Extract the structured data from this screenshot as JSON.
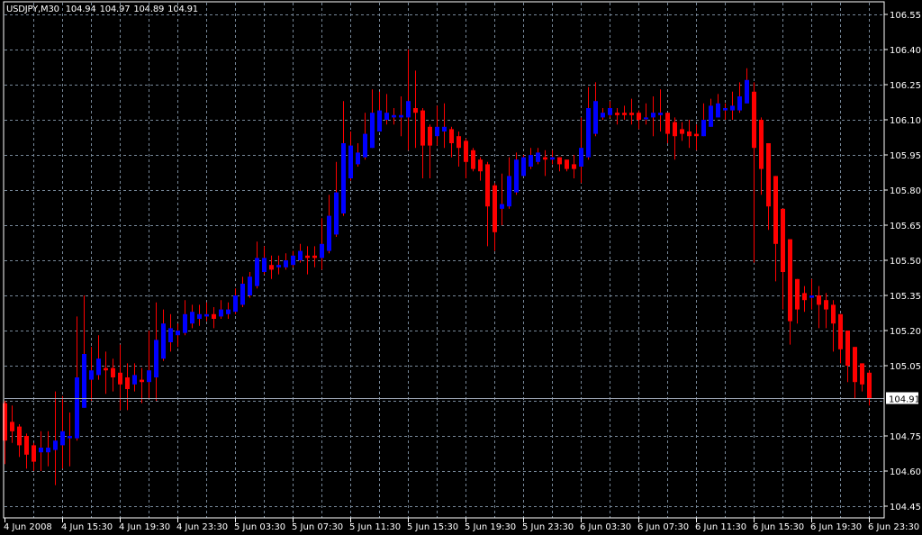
{
  "header": {
    "symbol": "USDJPY,M30",
    "open": "104.94",
    "high": "104.97",
    "low": "104.89",
    "close": "104.91"
  },
  "colors": {
    "background": "#000000",
    "grid": "#778899",
    "bull_body": "#0000ff",
    "bear_body": "#ff0000",
    "wick": "#ff0000",
    "frame": "#ffffff",
    "price_line": "#a0a8b8"
  },
  "chart_data": {
    "type": "candlestick",
    "title": "USDJPY,M30",
    "ylim": [
      104.45,
      106.55
    ],
    "grid": true,
    "y_ticks": [
      "106.55",
      "106.40",
      "106.25",
      "106.10",
      "105.95",
      "105.80",
      "105.65",
      "105.50",
      "105.35",
      "105.20",
      "105.05",
      "104.75",
      "104.60",
      "104.45"
    ],
    "grid_levels": [
      106.55,
      106.4,
      106.25,
      106.1,
      105.95,
      105.8,
      105.65,
      105.5,
      105.35,
      105.2,
      105.05,
      104.9,
      104.75,
      104.6,
      104.45
    ],
    "x_ticks": [
      "4 Jun 2008",
      "4 Jun 15:30",
      "4 Jun 19:30",
      "4 Jun 23:30",
      "5 Jun 03:30",
      "5 Jun 07:30",
      "5 Jun 11:30",
      "5 Jun 15:30",
      "5 Jun 19:30",
      "5 Jun 23:30",
      "6 Jun 03:30",
      "6 Jun 07:30",
      "6 Jun 11:30",
      "6 Jun 15:30",
      "6 Jun 19:30",
      "6 Jun 23:30"
    ],
    "bars_per_x_tick": 8,
    "current_price": "104.91",
    "ohlc": [
      [
        104.89,
        104.9,
        104.63,
        104.73
      ],
      [
        104.81,
        104.88,
        104.72,
        104.77
      ],
      [
        104.79,
        104.8,
        104.66,
        104.71
      ],
      [
        104.75,
        104.76,
        104.61,
        104.67
      ],
      [
        104.71,
        104.72,
        104.6,
        104.64
      ],
      [
        104.68,
        104.77,
        104.6,
        104.7
      ],
      [
        104.68,
        104.77,
        104.62,
        104.7
      ],
      [
        104.69,
        104.94,
        104.54,
        104.73
      ],
      [
        104.71,
        104.92,
        104.61,
        104.77
      ],
      [
        104.74,
        104.85,
        104.62,
        104.75
      ],
      [
        104.74,
        105.26,
        104.73,
        105.0
      ],
      [
        104.87,
        105.35,
        104.87,
        105.1
      ],
      [
        104.99,
        105.13,
        104.9,
        105.03
      ],
      [
        105.01,
        105.18,
        104.99,
        105.08
      ],
      [
        105.04,
        105.11,
        104.93,
        105.03
      ],
      [
        105.04,
        105.08,
        104.94,
        105.0
      ],
      [
        105.02,
        105.14,
        104.86,
        104.97
      ],
      [
        105.0,
        105.06,
        104.86,
        104.95
      ],
      [
        104.97,
        105.06,
        104.94,
        105.01
      ],
      [
        104.99,
        105.04,
        104.89,
        104.98
      ],
      [
        104.98,
        105.2,
        104.91,
        105.03
      ],
      [
        105.0,
        105.32,
        104.9,
        105.16
      ],
      [
        105.08,
        105.29,
        105.07,
        105.23
      ],
      [
        105.15,
        105.27,
        105.11,
        105.21
      ],
      [
        105.18,
        105.23,
        105.13,
        105.2
      ],
      [
        105.19,
        105.33,
        105.18,
        105.27
      ],
      [
        105.23,
        105.31,
        105.21,
        105.28
      ],
      [
        105.25,
        105.31,
        105.22,
        105.27
      ],
      [
        105.26,
        105.32,
        105.24,
        105.27
      ],
      [
        105.27,
        105.3,
        105.21,
        105.25
      ],
      [
        105.26,
        105.33,
        105.25,
        105.29
      ],
      [
        105.27,
        105.32,
        105.25,
        105.29
      ],
      [
        105.28,
        105.38,
        105.27,
        105.35
      ],
      [
        105.31,
        105.43,
        105.3,
        105.4
      ],
      [
        105.35,
        105.45,
        105.34,
        105.43
      ],
      [
        105.39,
        105.58,
        105.38,
        105.51
      ],
      [
        105.45,
        105.56,
        105.44,
        105.51
      ],
      [
        105.48,
        105.52,
        105.42,
        105.46
      ],
      [
        105.47,
        105.52,
        105.44,
        105.48
      ],
      [
        105.47,
        105.53,
        105.46,
        105.5
      ],
      [
        105.48,
        105.54,
        105.47,
        105.52
      ],
      [
        105.5,
        105.57,
        105.49,
        105.54
      ],
      [
        105.52,
        105.56,
        105.44,
        105.51
      ],
      [
        105.52,
        105.56,
        105.47,
        105.51
      ],
      [
        105.51,
        105.68,
        105.46,
        105.57
      ],
      [
        105.54,
        105.78,
        105.53,
        105.69
      ],
      [
        105.61,
        105.92,
        105.6,
        105.79
      ],
      [
        105.7,
        106.18,
        105.69,
        106.0
      ],
      [
        105.85,
        106.05,
        105.84,
        105.99
      ],
      [
        105.91,
        106.0,
        105.9,
        105.96
      ],
      [
        105.94,
        106.13,
        105.93,
        106.04
      ],
      [
        105.98,
        106.23,
        105.98,
        106.13
      ],
      [
        106.05,
        106.22,
        106.05,
        106.14
      ],
      [
        106.1,
        106.21,
        106.08,
        106.13
      ],
      [
        106.11,
        106.15,
        106.08,
        106.12
      ],
      [
        106.11,
        106.2,
        106.03,
        106.12
      ],
      [
        106.11,
        106.4,
        105.97,
        106.18
      ],
      [
        106.15,
        106.31,
        105.98,
        106.13
      ],
      [
        106.14,
        106.15,
        105.85,
        105.99
      ],
      [
        106.07,
        106.08,
        105.85,
        105.99
      ],
      [
        106.03,
        106.16,
        105.99,
        106.07
      ],
      [
        106.05,
        106.17,
        105.98,
        106.07
      ],
      [
        106.06,
        106.07,
        105.94,
        106.0
      ],
      [
        106.03,
        106.05,
        105.9,
        105.98
      ],
      [
        106.01,
        106.02,
        105.85,
        105.92
      ],
      [
        105.97,
        105.98,
        105.88,
        105.89
      ],
      [
        105.93,
        105.94,
        105.84,
        105.88
      ],
      [
        105.91,
        105.92,
        105.56,
        105.73
      ],
      [
        105.82,
        105.83,
        105.54,
        105.62
      ],
      [
        105.72,
        105.87,
        105.65,
        105.74
      ],
      [
        105.73,
        105.94,
        105.72,
        105.86
      ],
      [
        105.79,
        105.96,
        105.78,
        105.93
      ],
      [
        105.86,
        105.95,
        105.86,
        105.94
      ],
      [
        105.9,
        105.98,
        105.89,
        105.95
      ],
      [
        105.92,
        105.98,
        105.91,
        105.96
      ],
      [
        105.94,
        105.97,
        105.86,
        105.93
      ],
      [
        105.93,
        105.97,
        105.91,
        105.94
      ],
      [
        105.94,
        105.94,
        105.88,
        105.91
      ],
      [
        105.93,
        105.93,
        105.88,
        105.89
      ],
      [
        105.91,
        105.95,
        105.85,
        105.89
      ],
      [
        105.9,
        106.11,
        105.83,
        105.98
      ],
      [
        105.94,
        106.24,
        105.93,
        106.15
      ],
      [
        106.04,
        106.26,
        106.03,
        106.18
      ],
      [
        106.11,
        106.15,
        106.1,
        106.13
      ],
      [
        106.12,
        106.18,
        106.11,
        106.15
      ],
      [
        106.13,
        106.15,
        106.08,
        106.12
      ],
      [
        106.13,
        106.16,
        106.1,
        106.12
      ],
      [
        106.13,
        106.19,
        106.08,
        106.12
      ],
      [
        106.13,
        106.14,
        106.06,
        106.1
      ],
      [
        106.11,
        106.17,
        106.08,
        106.11
      ],
      [
        106.11,
        106.2,
        106.03,
        106.13
      ],
      [
        106.12,
        106.23,
        106.05,
        106.13
      ],
      [
        106.13,
        106.13,
        106.0,
        106.04
      ],
      [
        106.09,
        106.11,
        105.93,
        106.03
      ],
      [
        106.06,
        106.09,
        106.01,
        106.04
      ],
      [
        106.05,
        106.1,
        105.98,
        106.03
      ],
      [
        106.04,
        106.08,
        105.97,
        106.03
      ],
      [
        106.03,
        106.17,
        106.03,
        106.1
      ],
      [
        106.07,
        106.19,
        106.07,
        106.16
      ],
      [
        106.11,
        106.21,
        106.11,
        106.17
      ],
      [
        106.14,
        106.17,
        106.1,
        106.15
      ],
      [
        106.14,
        106.22,
        106.1,
        106.16
      ],
      [
        106.14,
        106.26,
        106.13,
        106.2
      ],
      [
        106.17,
        106.32,
        106.17,
        106.27
      ],
      [
        106.22,
        106.26,
        105.49,
        105.98
      ],
      [
        106.1,
        106.11,
        105.78,
        105.89
      ],
      [
        106.0,
        106.0,
        105.63,
        105.73
      ],
      [
        105.86,
        105.86,
        105.41,
        105.57
      ],
      [
        105.72,
        105.72,
        105.29,
        105.45
      ],
      [
        105.59,
        105.59,
        105.14,
        105.24
      ],
      [
        105.42,
        105.42,
        105.23,
        105.29
      ],
      [
        105.36,
        105.39,
        105.28,
        105.33
      ],
      [
        105.34,
        105.42,
        105.29,
        105.35
      ],
      [
        105.35,
        105.39,
        105.21,
        105.31
      ],
      [
        105.33,
        105.36,
        105.21,
        105.29
      ],
      [
        105.31,
        105.33,
        105.11,
        105.23
      ],
      [
        105.27,
        105.27,
        105.06,
        105.12
      ],
      [
        105.2,
        105.2,
        104.98,
        105.05
      ],
      [
        105.13,
        105.13,
        104.91,
        104.98
      ],
      [
        105.06,
        105.06,
        104.94,
        104.97
      ],
      [
        105.02,
        105.03,
        104.88,
        104.91
      ]
    ]
  }
}
